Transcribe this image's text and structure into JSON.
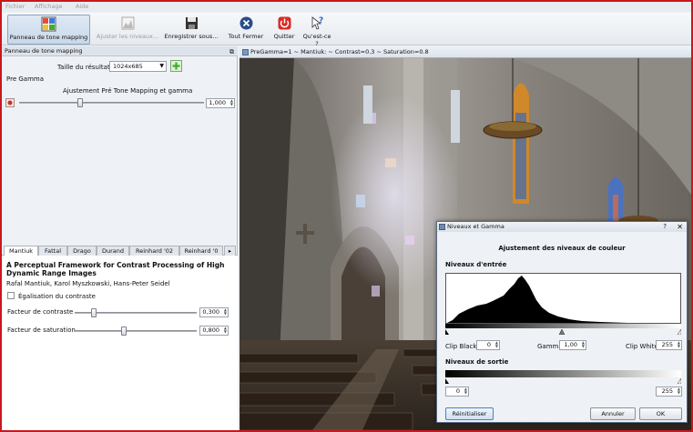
{
  "menu": {
    "items": [
      "Fichier",
      "Affichage",
      "Aide"
    ]
  },
  "toolbar": {
    "buttons": [
      {
        "label": "Panneau de tone mapping",
        "icon": "tonemap-panel-icon",
        "state": "active"
      },
      {
        "label": "Ajuster les niveaux...",
        "icon": "levels-icon",
        "state": "disabled"
      },
      {
        "label": "Enregistrer sous...",
        "icon": "floppy-disk-icon",
        "state": "normal"
      },
      {
        "label": "Tout Fermer",
        "icon": "close-all-icon",
        "state": "normal"
      },
      {
        "label": "Quitter",
        "icon": "power-icon",
        "state": "normal"
      },
      {
        "label": "Qu'est-ce ?",
        "icon": "whats-this-icon",
        "state": "normal"
      }
    ]
  },
  "tonemap_panel": {
    "title": "Panneau de tone mapping",
    "result_size_label": "Taille du résultat :",
    "result_size_value": "1024x685",
    "pregamma_label": "Pre Gamma",
    "pregamma_adjust_label": "Ajustement Pré Tone Mapping et gamma",
    "pregamma_value": "1,000",
    "pregamma_fraction": 0.33
  },
  "operator_tabs": [
    "Mantiuk",
    "Fattal",
    "Drago",
    "Durand",
    "Reinhard '02",
    "Reinhard '0"
  ],
  "mantiuk": {
    "title": "A Perceptual Framework for Contrast Processing of High Dynamic Range Images",
    "authors": "Rafal Mantiuk, Karol Myszkowski, Hans-Peter Seidel",
    "equalize_label": "Égalisation du contraste",
    "contrast_label": "Facteur de contraste",
    "contrast_value": "0,300",
    "contrast_fraction": 0.16,
    "saturation_label": "Facteur de saturation",
    "saturation_value": "0,800",
    "saturation_fraction": 0.4
  },
  "viewer": {
    "title": "PreGamma=1 ~ Mantiuk: ~ Contrast=0.3 ~ Saturation=0.8"
  },
  "levels_dialog": {
    "title": "Niveaux et Gamma",
    "heading": "Ajustement des niveaux de couleur",
    "input_levels_label": "Niveaux d'entrée",
    "clip_black_label": "Clip Black",
    "clip_black_value": "0",
    "gamma_label": "Gamma",
    "gamma_value": "1,00",
    "clip_white_label": "Clip White",
    "clip_white_value": "255",
    "output_levels_label": "Niveaux de sortie",
    "output_min_value": "0",
    "output_max_value": "255",
    "reset_label": "Réinitialiser",
    "cancel_label": "Annuler",
    "ok_label": "OK",
    "help_glyph": "?",
    "close_glyph": "✕"
  },
  "colors": {
    "frame_red": "#c9171e",
    "accent_green": "#3fae2a",
    "panel_bg": "#eef1f5"
  }
}
